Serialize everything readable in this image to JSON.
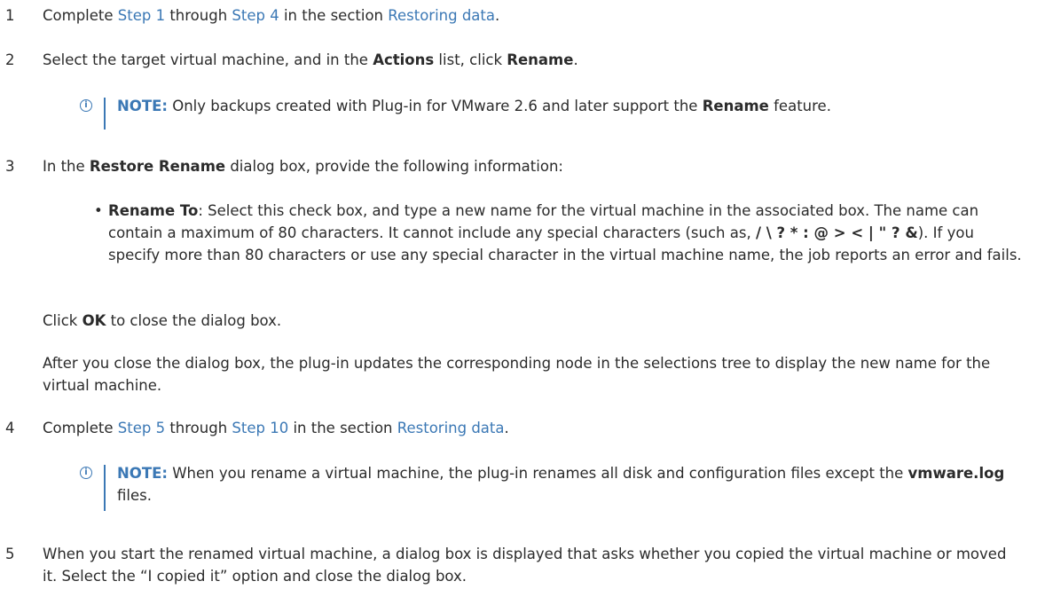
{
  "step1": {
    "number": "1",
    "text_a": "Complete ",
    "link_a": "Step 1",
    "text_b": " through ",
    "link_b": "Step 4",
    "text_c": " in the section ",
    "link_c": "Restoring data",
    "text_d": "."
  },
  "step2": {
    "number": "2",
    "text_a": "Select the target virtual machine, and in the ",
    "bold_a": "Actions",
    "text_b": " list, click ",
    "bold_b": "Rename",
    "text_c": "."
  },
  "note1": {
    "label": "NOTE:",
    "text_a": " Only backups created with Plug-in for VMware 2.6 and later support the ",
    "bold_a": "Rename",
    "text_b": " feature."
  },
  "step3": {
    "number": "3",
    "text_a": "In the ",
    "bold_a": "Restore Rename",
    "text_b": " dialog box, provide the following information:"
  },
  "bullet1": {
    "mark": "•",
    "bold_a": "Rename To",
    "text_a": ": Select this check box, and type a new name for the virtual machine in the associated box. The name can contain a maximum of 80 characters. It cannot include any special characters (such as, ",
    "bold_b": "/ \\ ? * : @ > < | \" ? &",
    "text_b": "). If you specify more than 80 characters or use any special character in the virtual machine name, the job reports an error and fails."
  },
  "para1": {
    "text_a": "Click ",
    "bold_a": "OK",
    "text_b": " to close the dialog box."
  },
  "para2": {
    "text": "After you close the dialog box, the plug-in updates the corresponding node in the selections tree to display the new name for the virtual machine."
  },
  "step4": {
    "number": "4",
    "text_a": "Complete ",
    "link_a": "Step 5",
    "text_b": " through ",
    "link_b": "Step 10",
    "text_c": " in the section ",
    "link_c": "Restoring data",
    "text_d": "."
  },
  "note2": {
    "label": "NOTE:",
    "text_a": " When you rename a virtual machine, the plug-in renames all disk and configuration files except the ",
    "bold_a": "vmware.log",
    "text_b": " files."
  },
  "step5": {
    "number": "5",
    "text": "When you start the renamed virtual machine, a dialog box is displayed that asks whether you copied the virtual machine or moved it. Select the “I copied it” option and close the dialog box."
  },
  "colors": {
    "text": "#2b2b2b",
    "link": "#3b78b5",
    "note_accent": "#3b78b5"
  },
  "icons": {
    "note": "info-circle-icon"
  }
}
